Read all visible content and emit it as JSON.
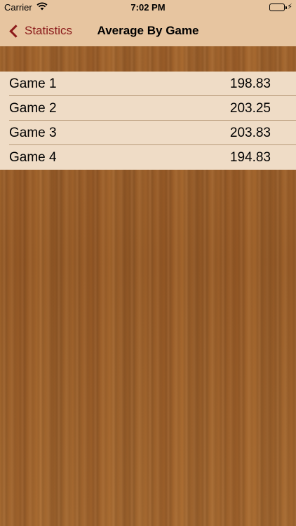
{
  "status_bar": {
    "carrier": "Carrier",
    "time": "7:02 PM",
    "battery_icon": "battery-charging-icon",
    "battery_color": "#4cd964"
  },
  "nav": {
    "back_label": "Statistics",
    "title": "Average By Game",
    "accent_color": "#8b1a1a"
  },
  "rows": [
    {
      "label": "Game 1",
      "value": "198.83"
    },
    {
      "label": "Game 2",
      "value": "203.25"
    },
    {
      "label": "Game 3",
      "value": "203.83"
    },
    {
      "label": "Game 4",
      "value": "194.83"
    }
  ]
}
